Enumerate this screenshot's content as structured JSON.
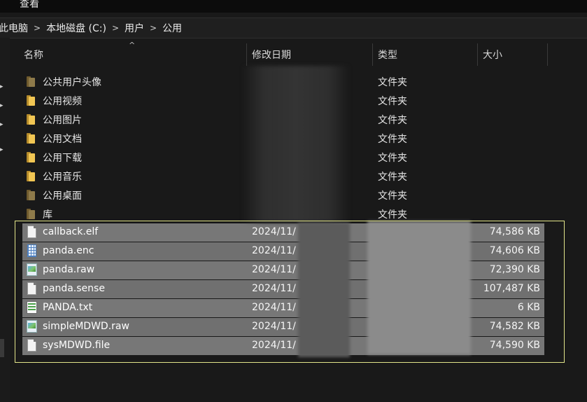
{
  "menubar": {
    "label": "查看"
  },
  "breadcrumb": {
    "items": [
      "此电脑",
      "本地磁盘 (C:)",
      "用户",
      "公用"
    ],
    "separator": ">"
  },
  "columns": {
    "name": "名称",
    "date": "修改日期",
    "type": "类型",
    "size": "大小"
  },
  "rows": [
    {
      "name": "公共用户头像",
      "date": "",
      "type": "文件夹",
      "size": "",
      "icon": "folder-icon"
    },
    {
      "name": "公用视频",
      "date": "",
      "type": "文件夹",
      "size": "",
      "icon": "folder-icon"
    },
    {
      "name": "公用图片",
      "date": "",
      "type": "文件夹",
      "size": "",
      "icon": "folder-icon"
    },
    {
      "name": "公用文档",
      "date": "",
      "type": "文件夹",
      "size": "",
      "icon": "folder-icon"
    },
    {
      "name": "公用下载",
      "date": "",
      "type": "文件夹",
      "size": "",
      "icon": "folder-icon"
    },
    {
      "name": "公用音乐",
      "date": "",
      "type": "文件夹",
      "size": "",
      "icon": "folder-icon"
    },
    {
      "name": "公用桌面",
      "date": "",
      "type": "文件夹",
      "size": "",
      "icon": "folder-icon"
    },
    {
      "name": "库",
      "date": "",
      "type": "文件夹",
      "size": "",
      "icon": "folder-icon"
    },
    {
      "name": "callback.elf",
      "date": "2024/11/",
      "type": "",
      "size": "74,586 KB",
      "icon": "file-icon"
    },
    {
      "name": "panda.enc",
      "date": "2024/11/",
      "type": "",
      "size": "74,606 KB",
      "icon": "calc-file-icon"
    },
    {
      "name": "panda.raw",
      "date": "2024/11/",
      "type": "",
      "size": "72,390 KB",
      "icon": "image-file-icon"
    },
    {
      "name": "panda.sense",
      "date": "2024/11/",
      "type": "",
      "size": "107,487 KB",
      "icon": "file-icon"
    },
    {
      "name": "PANDA.txt",
      "date": "2024/11/",
      "type": "",
      "size": "6 KB",
      "icon": "text-file-icon"
    },
    {
      "name": "simpleMDWD.raw",
      "date": "2024/11/",
      "type": "",
      "size": "74,582 KB",
      "icon": "image-file-icon"
    },
    {
      "name": "sysMDWD.file",
      "date": "2024/11/",
      "type": "",
      "size": "74,590 KB",
      "icon": "file-icon"
    }
  ],
  "colors": {
    "background": "#191919",
    "selection": "#777777",
    "selection_frame": "#e3e68a",
    "folder": "#f1c653"
  }
}
